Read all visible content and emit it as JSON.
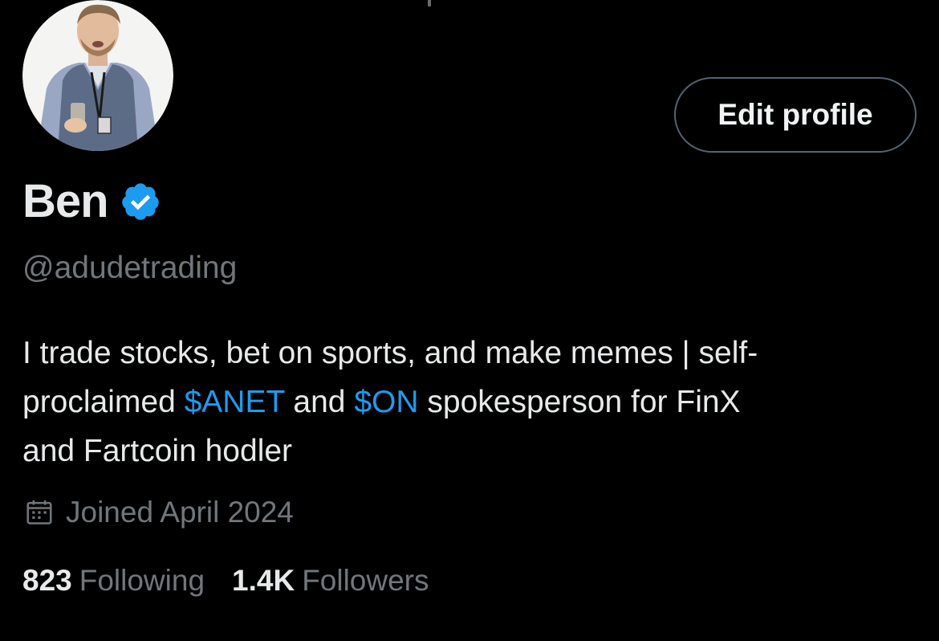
{
  "profile": {
    "display_name": "Ben",
    "handle": "@adudetrading",
    "verified_icon": "verified-badge-icon",
    "edit_button_label": "Edit profile",
    "bio": {
      "line_1": "I trade stocks, bet on sports, and make memes | self-",
      "line_2_prefix": "proclaimed ",
      "cashtag_1": "$ANET",
      "line_2_mid": " and ",
      "cashtag_2": "$ON",
      "line_2_suffix": " spokesperson for FinX",
      "line_3": "and Fartcoin hodler"
    },
    "joined_icon": "calendar-icon",
    "joined": "Joined April 2024",
    "following_count": "823",
    "following_label": "Following",
    "followers_count": "1.4K",
    "followers_label": "Followers"
  },
  "colors": {
    "background": "#000000",
    "primary_text": "#e7e9ea",
    "secondary_text": "#71767b",
    "accent_blue": "#1d9bf0",
    "button_border": "#536471"
  }
}
